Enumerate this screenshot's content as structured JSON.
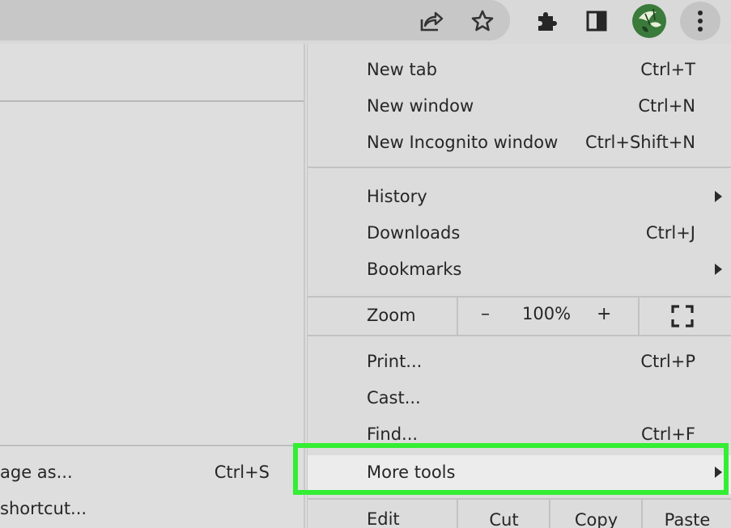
{
  "toolbar": {
    "icons": [
      "share-icon",
      "star-icon",
      "extensions-icon",
      "side-panel-icon",
      "profile-avatar",
      "more-menu-icon"
    ]
  },
  "page_behind": {
    "items": [
      {
        "label": "age as...",
        "shortcut": "Ctrl+S"
      },
      {
        "label": "shortcut...",
        "shortcut": ""
      }
    ]
  },
  "menu": {
    "group1": [
      {
        "label": "New tab",
        "shortcut": "Ctrl+T"
      },
      {
        "label": "New window",
        "shortcut": "Ctrl+N"
      },
      {
        "label": "New Incognito window",
        "shortcut": "Ctrl+Shift+N"
      }
    ],
    "group2": [
      {
        "label": "History",
        "shortcut": ""
      },
      {
        "label": "Downloads",
        "shortcut": "Ctrl+J"
      },
      {
        "label": "Bookmarks",
        "shortcut": ""
      }
    ],
    "zoom": {
      "label": "Zoom",
      "minus": "–",
      "value": "100%",
      "plus": "+"
    },
    "group3": [
      {
        "label": "Print...",
        "shortcut": "Ctrl+P"
      },
      {
        "label": "Cast...",
        "shortcut": ""
      },
      {
        "label": "Find...",
        "shortcut": "Ctrl+F"
      },
      {
        "label": "More tools",
        "shortcut": ""
      }
    ],
    "edit": {
      "label": "Edit",
      "cut": "Cut",
      "copy": "Copy",
      "paste": "Paste"
    }
  },
  "colors": {
    "highlight": "#33ee33"
  }
}
